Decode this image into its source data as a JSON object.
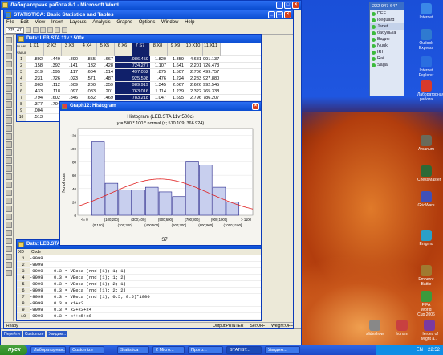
{
  "word": {
    "title": "Лабораторная работа 8-1 - Microsoft Word"
  },
  "statistica": {
    "title": "STATISTICA: Basic Statistics and Tables",
    "menu": [
      "File",
      "Edit",
      "View",
      "Insert",
      "Layouts",
      "Analysis",
      "Graphs",
      "Options",
      "Window",
      "Help"
    ],
    "zoom": "375, 47",
    "status": [
      "Ready",
      "Output:PRINTER",
      "Sel:OFF",
      "Weight:OFF"
    ]
  },
  "data_window": {
    "title": "Data: LEB.STA 11v * 500c",
    "col_hdr_label": "NUMERIC VALUES",
    "columns": [
      "1 X1",
      "2 X2",
      "3 X3",
      "4 X4",
      "5 X5",
      "6 X6",
      "7 S7",
      "8 X8",
      "9 X9",
      "10 X10",
      "11 X11"
    ],
    "rows": [
      [
        ".892",
        ".449",
        ".890",
        ".855",
        ".667",
        ".986.459",
        "1.820",
        "1.359",
        "4.681",
        "991.137"
      ],
      [
        ".158",
        ".392",
        ".141",
        ".132",
        ".428",
        "724.277",
        "1.107",
        "1.641",
        "2.201",
        "726.473"
      ],
      [
        ".319",
        ".595",
        ".117",
        ".604",
        ".514",
        "497.052",
        ".875",
        "1.507",
        "2.706",
        "499.757"
      ],
      [
        ".231",
        ".726",
        ".023",
        ".571",
        ".487",
        "925.598",
        ".476",
        "1.224",
        "2.283",
        "927.880"
      ],
      [
        ".903",
        ".112",
        ".609",
        ".200",
        ".359",
        "989.919",
        "1.345",
        "2.067",
        "2.626",
        "992.545"
      ],
      [
        ".433",
        ".118",
        ".097",
        ".083",
        ".201",
        "763.016",
        "1.114",
        "1.239",
        "2.322",
        "765.338"
      ],
      [
        ".794",
        ".602",
        ".846",
        ".632",
        ".469",
        "783.218",
        "1.047",
        "1.695",
        "2.796",
        "786.207"
      ],
      [
        ".377",
        ".704",
        ".040",
        ".003",
        ".711",
        "783.407",
        ".844",
        "1.201",
        "2.204",
        "785.611"
      ],
      [
        ".004"
      ],
      [
        ".513"
      ],
      [
        ".263"
      ],
      [
        ".133"
      ],
      [
        ".107"
      ],
      [
        ".260"
      ],
      [
        ".660"
      ],
      [
        ".678"
      ],
      [
        ".870"
      ]
    ]
  },
  "graph": {
    "title": "Graph12: Histogram",
    "heading": "Histogram (LEB.STA 11v*500c)",
    "subheading": "y = 500 * 100 * normal (x; 510.109; 366.924)",
    "xlabel": "S7",
    "ylabel": "No of obs"
  },
  "chart_data": {
    "type": "bar",
    "title": "Histogram (LEB.STA 11v*500c)",
    "subtitle": "y = 500 * 100 * normal (x; 510.109; 366.924)",
    "xlabel": "S7",
    "ylabel": "No of obs",
    "categories": [
      "<= 0",
      "(0;100]",
      "(100;200]",
      "(200;300]",
      "(300;400]",
      "(400;500]",
      "(500;600]",
      "(600;700]",
      "(700;800]",
      "(800;900]",
      "(900;1000]",
      "(1000;1100]",
      "> 1100"
    ],
    "tick_labels_top": [
      "<= 0",
      "(100;200]",
      "(300;400]",
      "(500;600]",
      "(700;800]",
      "(900;1000]",
      "> 1100"
    ],
    "tick_labels_bottom": [
      "(0;100]",
      "(200;300]",
      "(400;500]",
      "(600;700]",
      "(800;900]",
      "(1000;1100]"
    ],
    "values": [
      0,
      110,
      48,
      38,
      38,
      42,
      35,
      28,
      80,
      75,
      42,
      20,
      0
    ],
    "normal_curve": {
      "mean": 510.109,
      "sd": 366.924
    },
    "ylim": [
      0,
      130
    ],
    "bar_color": "#c8cfee",
    "curve_color": "#e02020"
  },
  "code_window": {
    "title": "Data: LEB.STA",
    "col_hdr": [
      "XD",
      "Code"
    ],
    "rows": [
      [
        "1",
        "-9999",
        "",
        ""
      ],
      [
        "2",
        "-9999",
        "",
        ""
      ],
      [
        "3",
        "-9999",
        "0.3",
        "= VBeta (rnd (1); 1; 1)"
      ],
      [
        "4",
        "-9999",
        "0.3",
        "= VBeta (rnd (1); 1; 2)"
      ],
      [
        "5",
        "-9999",
        "0.3",
        "= VBeta (rnd (1); 2; 1)"
      ],
      [
        "6",
        "-9999",
        "0.3",
        "= VBeta (rnd (1); 2; 2)"
      ],
      [
        "7",
        "-9999",
        "0.3",
        "= VBeta (rnd (1); 0.5; 0.5)*1000"
      ],
      [
        "8",
        "-9999",
        "0.3",
        "= x1+x2"
      ],
      [
        "9",
        "-9999",
        "0.3",
        "= x2+x3+x4"
      ],
      [
        "10",
        "-9999",
        "0.3",
        "= x4+x5+x6"
      ],
      [
        "11",
        "-9999",
        "0.3",
        "= x6+x7"
      ]
    ]
  },
  "icq": {
    "number": "222-947-647",
    "contacts": [
      "DEF",
      "Iceguard",
      "Janet",
      "бабулька",
      "Вадик",
      "Nuuki",
      "IRI",
      "Rai",
      "Saga"
    ]
  },
  "desktop_icons": [
    "Internet",
    "Outlook Express",
    "Internet Explorer",
    "Лабораторная работа",
    "Arcanum",
    "ChessMaster",
    "GridWars",
    "Enigmo",
    "Emperor Battle",
    "FIFA World Cup 2006",
    "Heroes of Might a...",
    "slideshow",
    "honsm"
  ],
  "taskbar": {
    "start": "пуск",
    "tasks": [
      "Лабораторная...",
      "Customize",
      "Statistica",
      "2 Micro...",
      "Прогр...",
      "STATIST...",
      "Увидим..."
    ],
    "clock": "22:52",
    "lang": "EN"
  },
  "word_bottom": [
    "Перейти",
    "Customize",
    "Увидим..."
  ]
}
